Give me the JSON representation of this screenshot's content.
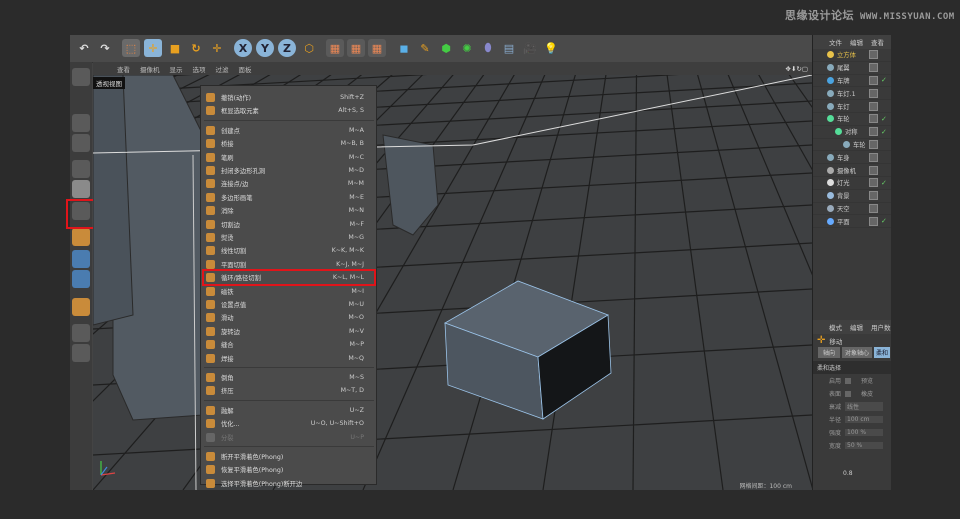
{
  "watermark": {
    "cn": "思缘设计论坛",
    "url": "WWW.MISSYUAN.COM"
  },
  "toolbar": {
    "icons": [
      "undo-icon",
      "redo-icon",
      "select-icon",
      "move-icon",
      "scale-icon",
      "rotate-icon",
      "transform-icon",
      "x-axis-icon",
      "y-axis-icon",
      "z-axis-icon",
      "world-coords-icon",
      "render-view-icon",
      "render-icon",
      "render-settings-icon",
      "cube-icon",
      "pen-icon",
      "subdivision-icon",
      "array-icon",
      "deformer-icon",
      "floor-icon",
      "camera-icon",
      "light-icon"
    ],
    "axis_labels": [
      "X",
      "Y",
      "Z"
    ]
  },
  "viewport": {
    "menu": [
      "查看",
      "摄像机",
      "显示",
      "选项",
      "过滤",
      "面板"
    ],
    "label": "透视视图",
    "status": "网格间距：100 cm"
  },
  "menu": {
    "groups": [
      [
        {
          "label": "撤销(动作)",
          "shortcut": "Shift+Z"
        },
        {
          "label": "框显选取元素",
          "shortcut": "Alt+S, S"
        }
      ],
      [
        {
          "label": "创建点",
          "shortcut": "M~A"
        },
        {
          "label": "桥接",
          "shortcut": "M~B, B"
        },
        {
          "label": "笔刷",
          "shortcut": "M~C"
        },
        {
          "label": "封闭多边形孔洞",
          "shortcut": "M~D"
        },
        {
          "label": "连接点/边",
          "shortcut": "M~M"
        },
        {
          "label": "多边形画笔",
          "shortcut": "M~E"
        },
        {
          "label": "消除",
          "shortcut": "M~N"
        },
        {
          "label": "切割边",
          "shortcut": "M~F"
        },
        {
          "label": "熨烫",
          "shortcut": "M~G"
        },
        {
          "label": "线性切割",
          "shortcut": "K~K, M~K"
        },
        {
          "label": "平面切割",
          "shortcut": "K~J, M~J"
        },
        {
          "label": "循环/路径切割",
          "shortcut": "K~L, M~L",
          "highlighted": true
        },
        {
          "label": "磁铁",
          "shortcut": "M~I"
        },
        {
          "label": "设置点值",
          "shortcut": "M~U"
        },
        {
          "label": "滑动",
          "shortcut": "M~O"
        },
        {
          "label": "旋转边",
          "shortcut": "M~V"
        },
        {
          "label": "缝合",
          "shortcut": "M~P"
        },
        {
          "label": "焊接",
          "shortcut": "M~Q"
        }
      ],
      [
        {
          "label": "倒角",
          "shortcut": "M~S"
        },
        {
          "label": "挤压",
          "shortcut": "M~T, D"
        }
      ],
      [
        {
          "label": "融解",
          "shortcut": "U~Z"
        },
        {
          "label": "优化...",
          "shortcut": "U~O, U~Shift+O"
        },
        {
          "label": "分裂",
          "shortcut": "U~P",
          "disabled": true
        }
      ],
      [
        {
          "label": "断开平滑着色(Phong)",
          "shortcut": ""
        },
        {
          "label": "恢复平滑着色(Phong)",
          "shortcut": ""
        },
        {
          "label": "选择平滑着色(Phong)断开边",
          "shortcut": ""
        }
      ]
    ]
  },
  "objects": {
    "header": [
      "文件",
      "编辑",
      "查看"
    ],
    "items": [
      {
        "name": "立方体",
        "icon": "cube-icon",
        "color": "#e8c24a",
        "active": true,
        "check": false
      },
      {
        "name": "尾翼",
        "icon": "null-icon",
        "color": "#8ab",
        "check": false
      },
      {
        "name": "车牌",
        "icon": "sphere-icon",
        "color": "#4aa3e0",
        "check": true
      },
      {
        "name": "车灯.1",
        "icon": "null-icon",
        "color": "#8ab",
        "check": false
      },
      {
        "name": "车灯",
        "icon": "null-icon",
        "color": "#8ab",
        "check": false
      },
      {
        "name": "车轮",
        "icon": "symmetry-icon",
        "color": "#5d9",
        "check": true
      },
      {
        "name": "对称",
        "icon": "symmetry-icon",
        "color": "#5d9",
        "check": true
      },
      {
        "name": "车轮",
        "icon": "null-icon",
        "color": "#8ab",
        "check": false
      },
      {
        "name": "车身",
        "icon": "cube-icon",
        "color": "#8ab",
        "check": false
      },
      {
        "name": "摄像机",
        "icon": "camera-icon",
        "color": "#aaa",
        "check": false
      },
      {
        "name": "灯光",
        "icon": "light-icon",
        "color": "#ddd",
        "check": true
      },
      {
        "name": "背景",
        "icon": "background-icon",
        "color": "#9bd",
        "check": false
      },
      {
        "name": "天空",
        "icon": "sky-icon",
        "color": "#9ab",
        "check": false
      },
      {
        "name": "平面",
        "icon": "plane-icon",
        "color": "#6af",
        "check": true
      }
    ]
  },
  "attributes": {
    "header": [
      "模式",
      "编辑",
      "用户数"
    ],
    "tool": "移动",
    "tabs": [
      "轴向",
      "对象轴心",
      "柔和"
    ],
    "section": "柔和选择",
    "fields": [
      {
        "label": "启用",
        "right": "预览"
      },
      {
        "label": "表面",
        "right": "橡皮"
      },
      {
        "label": "衰减",
        "value": "线性"
      },
      {
        "label": "半径",
        "value": "100 cm"
      },
      {
        "label": "强度",
        "value": "100 %"
      },
      {
        "label": "宽度",
        "value": "50 %"
      }
    ],
    "graph_tick": "0.8"
  },
  "highlight_color": "#e0141a"
}
